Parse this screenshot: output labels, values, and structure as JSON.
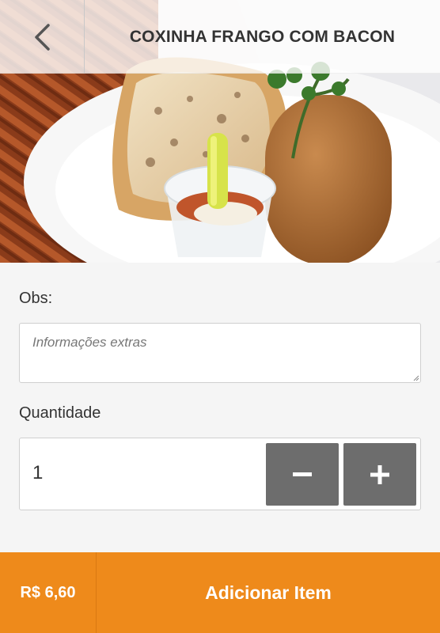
{
  "header": {
    "title": "COXINHA FRANGO COM BACON",
    "back_icon": "chevron-left-icon"
  },
  "product_image": {
    "icon": "food-photo"
  },
  "form": {
    "obs_label": "Obs:",
    "obs_placeholder": "Informações extras",
    "obs_value": "",
    "quantity_label": "Quantidade",
    "quantity_value": "1",
    "minus_icon": "minus-icon",
    "plus_icon": "plus-icon"
  },
  "footer": {
    "price": "R$ 6,60",
    "add_label": "Adicionar Item"
  },
  "colors": {
    "accent": "#ee8a1b",
    "stepper": "#6d6d6d",
    "background": "#f5f5f5"
  }
}
